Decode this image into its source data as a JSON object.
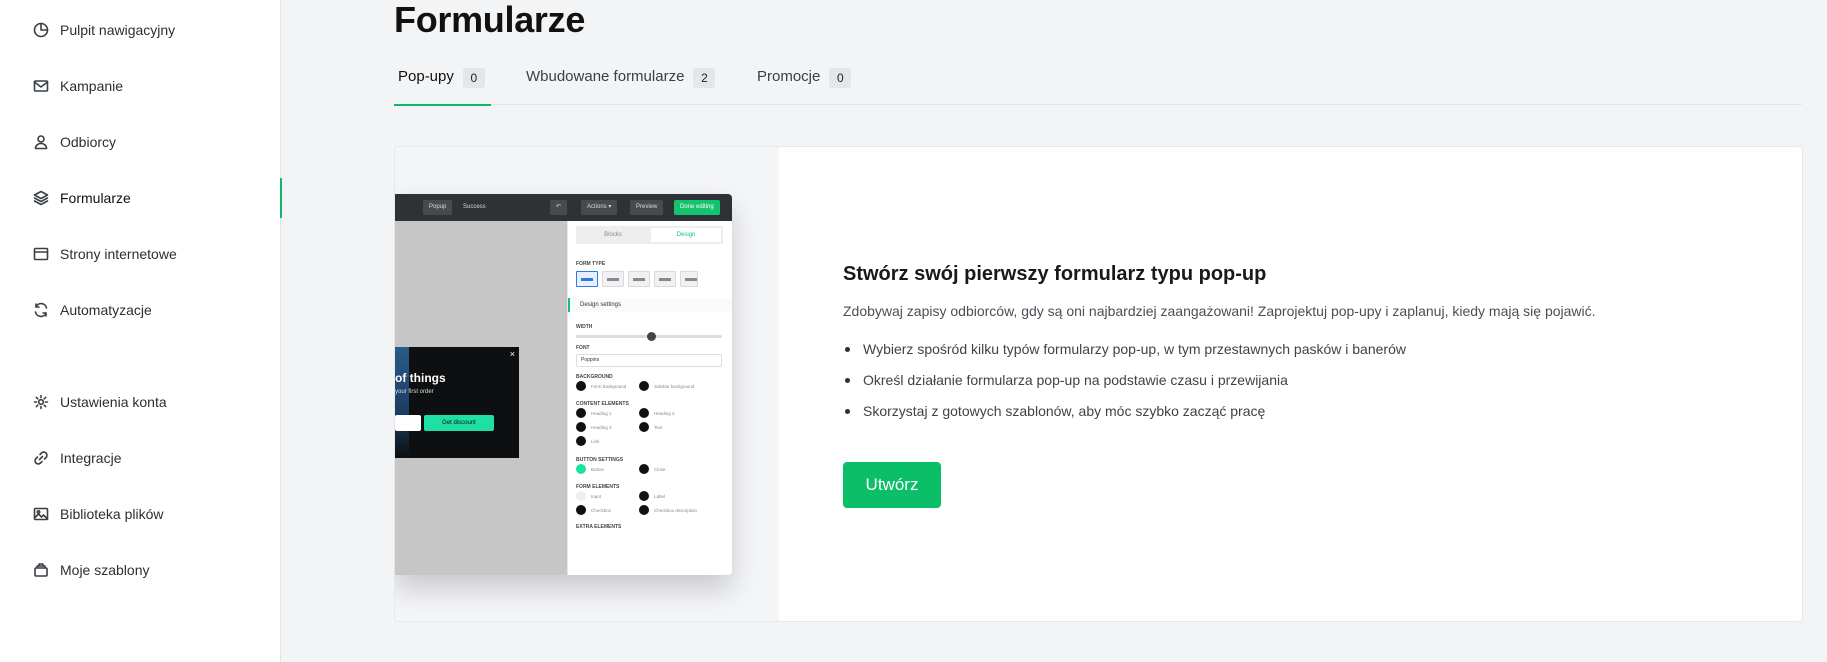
{
  "sidebar": {
    "items": [
      {
        "label": "Pulpit nawigacyjny",
        "icon": "dashboard-icon"
      },
      {
        "label": "Kampanie",
        "icon": "mail-icon"
      },
      {
        "label": "Odbiorcy",
        "icon": "user-icon"
      },
      {
        "label": "Formularze",
        "icon": "layers-icon",
        "active": true
      },
      {
        "label": "Strony internetowe",
        "icon": "browser-icon"
      },
      {
        "label": "Automatyzacje",
        "icon": "refresh-icon"
      },
      {
        "label": "Ustawienia konta",
        "icon": "gear-icon"
      },
      {
        "label": "Integracje",
        "icon": "link-icon"
      },
      {
        "label": "Biblioteka plików",
        "icon": "image-icon"
      },
      {
        "label": "Moje szablony",
        "icon": "template-icon"
      }
    ]
  },
  "main": {
    "title": "Formularze",
    "tabs": [
      {
        "label": "Pop-upy",
        "count": "0",
        "active": true
      },
      {
        "label": "Wbudowane formularze",
        "count": "2"
      },
      {
        "label": "Promocje",
        "count": "0"
      }
    ]
  },
  "empty_state": {
    "title": "Stwórz swój pierwszy formularz typu pop-up",
    "description": "Zdobywaj zapisy odbiorców, gdy są oni najbardziej zaangażowani! Zaprojektuj pop-upy i zaplanuj, kiedy mają się pojawić.",
    "bullets": [
      "Wybierz spośród kilku typów formularzy pop-up, w tym przestawnych pasków i banerów",
      "Określ działanie formularza pop-up na podstawie czasu i przewijania",
      "Skorzystaj z gotowych szablonów, aby móc szybko zacząć pracę"
    ],
    "create_label": "Utwórz"
  },
  "preview": {
    "topbar": {
      "popup_tab": "Popup",
      "success_tab": "Success",
      "undo": "↶",
      "actions": "Actions ▾",
      "preview": "Preview",
      "done": "Done editing"
    },
    "popup": {
      "title": "of things",
      "subtitle": "your first order",
      "button": "Get discount",
      "close": "×"
    },
    "panel": {
      "tab_blocks": "Blocks",
      "tab_design": "Design",
      "form_type": "FORM TYPE",
      "design_settings": "Design settings",
      "width": "WIDTH",
      "font": "FONT",
      "font_value": "Poppins",
      "background": "BACKGROUND",
      "bg_form": "Form background",
      "bg_sidebar": "Sidebar background",
      "content_elements": "CONTENT ELEMENTS",
      "heading1": "Heading 1",
      "heading2": "Heading 2",
      "heading3": "Heading 3",
      "text": "Text",
      "link": "Link",
      "button_settings": "BUTTON SETTINGS",
      "button": "Button",
      "close": "Close",
      "form_elements": "FORM ELEMENTS",
      "input": "Input",
      "label": "Label",
      "checkbox": "Checkbox",
      "checkbox_desc": "Checkbox description",
      "extra": "EXTRA ELEMENTS"
    }
  },
  "colors": {
    "accent": "#12b76a",
    "button": "#0bbf69",
    "background": "#f3f4f6"
  }
}
